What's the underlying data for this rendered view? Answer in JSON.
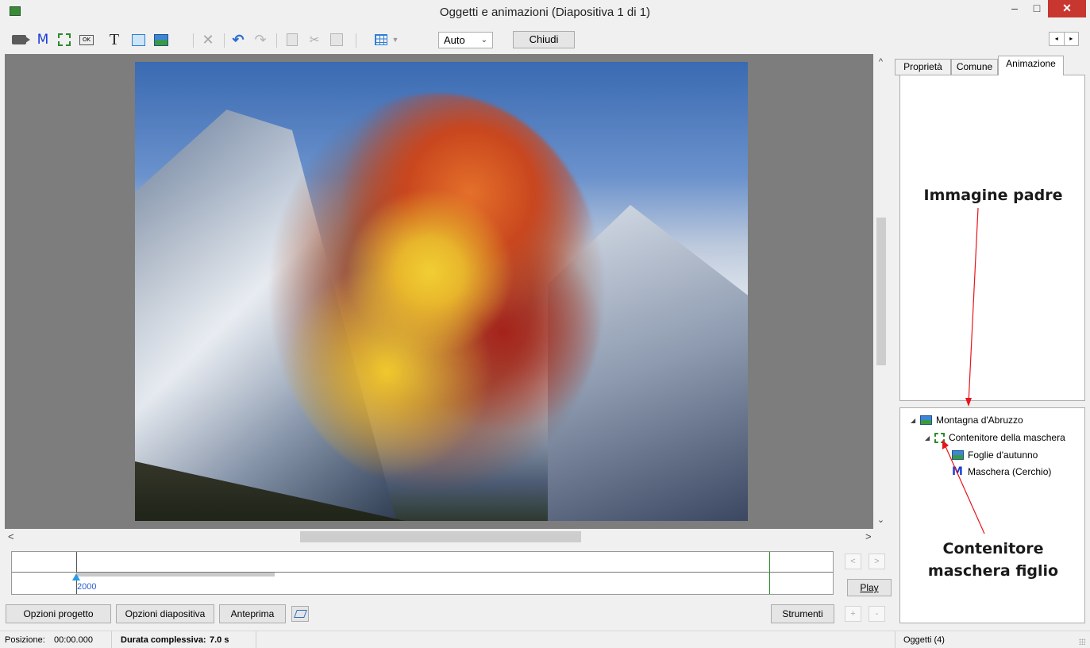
{
  "window": {
    "title": "Oggetti e animazioni  (Diapositiva 1 di 1)",
    "min_glyph": "–",
    "max_glyph": "□",
    "close_glyph": "✕"
  },
  "toolbar": {
    "zoom_value": "Auto",
    "close_label": "Chiudi",
    "icons": [
      "video-camera-icon",
      "mask-icon",
      "frame-icon",
      "button-icon",
      "text-icon",
      "rectangle-icon",
      "image-icon",
      "delete-icon",
      "undo-icon",
      "redo-icon",
      "copy-icon",
      "cut-icon",
      "paste-icon",
      "grid-icon"
    ]
  },
  "tabs": [
    {
      "label": "Proprietà"
    },
    {
      "label": "Comune"
    },
    {
      "label": "Animazione",
      "active": true
    }
  ],
  "tree": [
    {
      "label": "Montagna d'Abruzzo",
      "icon": "image-icon",
      "level": 0,
      "expanded": true
    },
    {
      "label": "Contenitore della maschera",
      "icon": "mask-container-icon",
      "level": 1,
      "expanded": true
    },
    {
      "label": "Foglie d'autunno",
      "icon": "image-icon",
      "level": 2
    },
    {
      "label": "Maschera (Cerchio)",
      "icon": "mask-icon",
      "level": 2
    }
  ],
  "timeline": {
    "time_label": "2000",
    "play_label": "Play"
  },
  "bottom_buttons": {
    "project_options": "Opzioni progetto",
    "slide_options": "Opzioni diapositiva",
    "preview": "Anteprima",
    "tools": "Strumenti"
  },
  "statusbar": {
    "position_label": "Posizione:",
    "position_value": "00:00.000",
    "duration_label": "Durata complessiva:",
    "duration_value": "7.0 s",
    "objects": "Oggetti (4)"
  },
  "annotations": {
    "parent_image": "Immagine padre",
    "child_container": "Contenitore\nmaschera figlio",
    "arrow_color": "#e8141b"
  }
}
